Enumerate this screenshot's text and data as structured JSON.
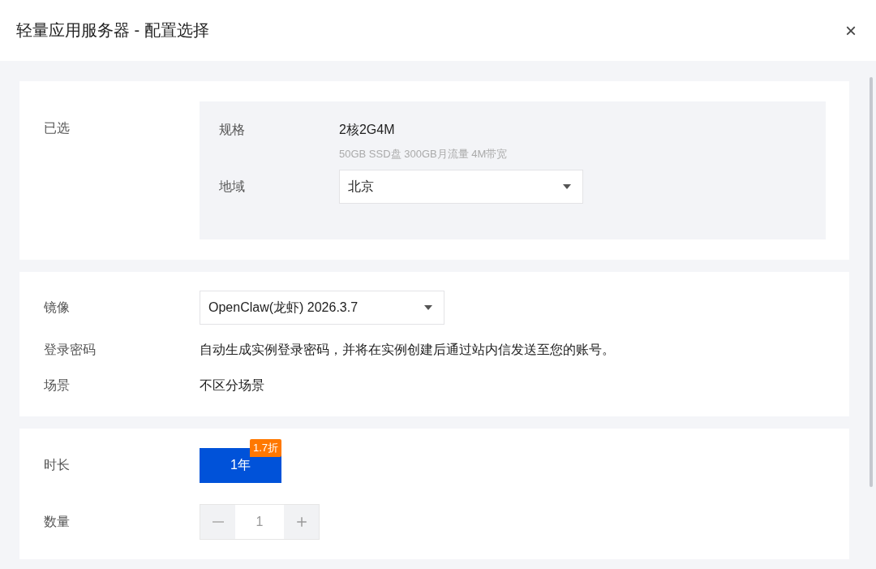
{
  "dialog": {
    "title": "轻量应用服务器 - 配置选择",
    "close": "×"
  },
  "selected_section": {
    "label": "已选",
    "spec": {
      "label": "规格",
      "value": "2核2G4M",
      "detail": "50GB SSD盘 300GB月流量 4M带宽"
    },
    "region": {
      "label": "地域",
      "value": "北京"
    }
  },
  "image_section": {
    "rows": [
      {
        "kind": "select",
        "label": "镜像",
        "value": "OpenClaw(龙虾) 2026.3.7"
      },
      {
        "kind": "text",
        "label": "登录密码",
        "value": "自动生成实例登录密码，并将在实例创建后通过站内信发送至您的账号。"
      },
      {
        "kind": "text",
        "label": "场景",
        "value": "不区分场景"
      }
    ]
  },
  "purchase_section": {
    "duration": {
      "label": "时长",
      "options": [
        {
          "label": "1年",
          "badge": "1.7折",
          "selected": true
        }
      ]
    },
    "quantity": {
      "label": "数量",
      "value": "1",
      "minus_disabled": true
    }
  }
}
